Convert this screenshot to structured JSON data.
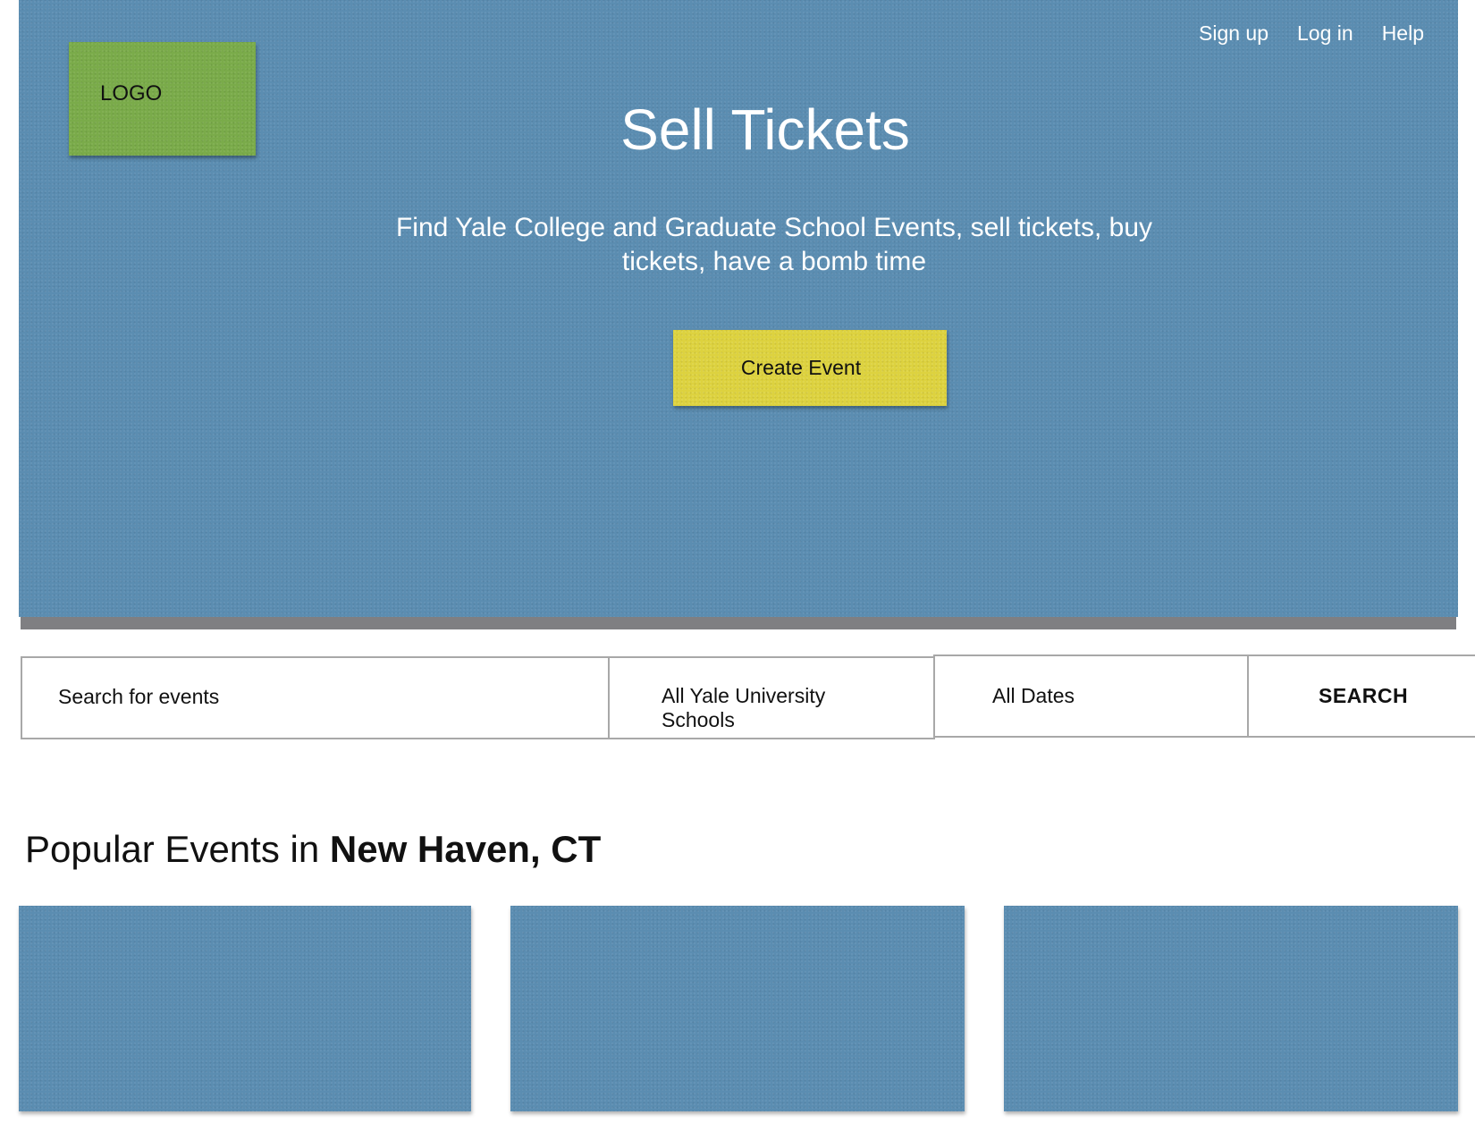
{
  "colors": {
    "hero_blue": "#5b8db1",
    "logo_green": "#7aab4a",
    "button_yellow": "#ddd23f",
    "text_white": "#ffffff"
  },
  "logo": {
    "label": "LOGO"
  },
  "nav": {
    "signup": "Sign up",
    "login": "Log in",
    "help": "Help"
  },
  "hero": {
    "title": "Sell Tickets",
    "subtitle": "Find Yale College and Graduate School Events, sell tickets, buy tickets, have a bomb time",
    "create_button": "Create Event"
  },
  "search": {
    "placeholder": "Search for events",
    "school_filter": "All Yale University Schools",
    "date_filter": "All Dates",
    "button": "SEARCH"
  },
  "popular": {
    "prefix": "Popular Events in ",
    "location": "New Haven, CT"
  },
  "events": [
    {},
    {},
    {}
  ]
}
